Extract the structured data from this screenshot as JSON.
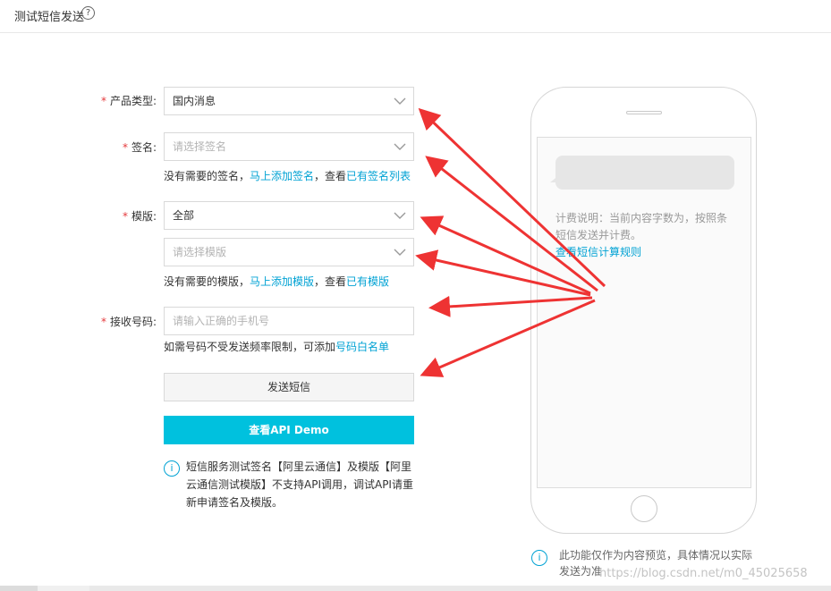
{
  "header": {
    "title": "测试短信发送",
    "help_icon": "?"
  },
  "form": {
    "required_mark": "*",
    "product_type": {
      "label": "产品类型:",
      "value": "国内消息"
    },
    "signature": {
      "label": "签名:",
      "placeholder": "请选择签名",
      "hint_prefix": "没有需要的签名，",
      "hint_link1": "马上添加签名",
      "hint_mid": "，查看",
      "hint_link2": "已有签名列表"
    },
    "template": {
      "label": "模版:",
      "category_value": "全部",
      "placeholder": "请选择模版",
      "hint_prefix": "没有需要的模版，",
      "hint_link1": "马上添加模版",
      "hint_mid": "，查看",
      "hint_link2": "已有模版"
    },
    "phone": {
      "label": "接收号码:",
      "placeholder": "请输入正确的手机号",
      "hint_prefix": "如需号码不受发送频率限制，可添加",
      "hint_link": "号码白名单"
    },
    "send_button": "发送短信",
    "demo_button": "查看API Demo",
    "notice_line1": "短信服务测试签名【阿里云通信】及模版【阿里",
    "notice_line2": "云通信测试模版】不支持API调用，调试API请重",
    "notice_line3": "新申请签名及模版。"
  },
  "phone_preview": {
    "fee_line1": "计费说明：当前内容字数为，按照条",
    "fee_line2": "短信发送并计费。",
    "fee_link": "查看短信计算规则",
    "note_line1": "此功能仅作为内容预览，具体情况以实际",
    "note_line2": "发送为准"
  },
  "watermark": "https://blog.csdn.net/m0_45025658",
  "colors": {
    "accent": "#00c1de",
    "link": "#00a2d4",
    "required": "#e4393c",
    "arrow": "#ee3333"
  },
  "icons": {
    "chevron": "chevron-down-icon",
    "info": "info-icon",
    "help": "question-circle-icon"
  }
}
